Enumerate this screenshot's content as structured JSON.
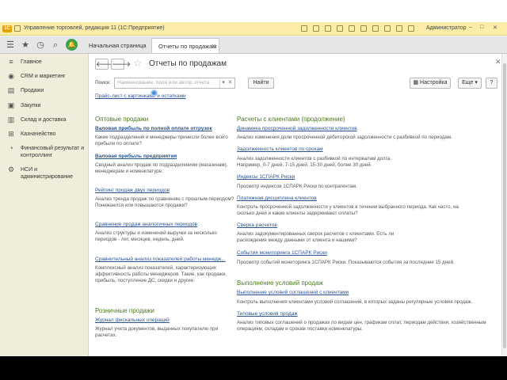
{
  "titlebar": {
    "title": "Управление торговлей, редакция 11  (1С:Предприятие)",
    "user": "Администратор"
  },
  "topbar": {
    "tabs": [
      {
        "label": "Начальная страница"
      },
      {
        "label": "Отчеты по продажам"
      }
    ]
  },
  "sidebar": {
    "items": [
      {
        "label": "Главное",
        "icon": "menu-icon"
      },
      {
        "label": "CRM и маркетинг",
        "icon": "crm-icon"
      },
      {
        "label": "Продажи",
        "icon": "sales-icon"
      },
      {
        "label": "Закупки",
        "icon": "purchases-icon"
      },
      {
        "label": "Склад и доставка",
        "icon": "warehouse-icon"
      },
      {
        "label": "Казначейство",
        "icon": "treasury-icon"
      },
      {
        "label": "Финансовый результат и контроллинг",
        "icon": "finance-icon"
      },
      {
        "label": "НСИ и администрирование",
        "icon": "settings-icon"
      }
    ]
  },
  "main": {
    "title": "Отчеты по продажам",
    "search": {
      "label": "Поиск:",
      "placeholder": "Наименование, поля или автор отчета",
      "find_button": "Найти"
    },
    "settings_button": "Настройка",
    "more_button": "Еще",
    "help_button": "?",
    "price_link": "Прайс-лист с картинками и остатками",
    "left_sections": [
      {
        "heading": "Оптовые продажи",
        "reports": [
          {
            "title": "Валовая прибыль по полной оплате отгрузок",
            "bold": true,
            "desc": "Какие подразделения и менеджеры принесли более всего прибыли по оплате?"
          },
          {
            "title": "Валовая прибыль предприятия",
            "bold": true,
            "desc": "Сводный анализ продаж по подразделениям (магазинам), менеджерам и номенклатуре."
          },
          {
            "title": "Рейтинг продаж двух периодов",
            "bold": false,
            "desc": "Анализ тренда продаж по сравнению с прошлым периодом? Понижаются или повышаются продажи?"
          },
          {
            "title": "Сравнение продаж аналогичных периодов",
            "bold": false,
            "desc": "Анализ структуры и изменений выручки за несколько периодов - лет, месяцев, недель, дней."
          },
          {
            "title": "Сравнительный анализ показателей работы менедж...",
            "bold": false,
            "desc": "Комплексный анализ показателей, характеризующих эффективность работы менеджеров. Такие, как продажи, прибыль, поступление ДС, скидки и другие."
          }
        ]
      },
      {
        "heading": "Розничные продажи",
        "reports": [
          {
            "title": "Журнал фискальных операций",
            "bold": false,
            "desc": "Журнал учета документов, выданных покупателю при расчетах."
          }
        ]
      }
    ],
    "right_sections": [
      {
        "heading": "Расчеты с клиентами (продолжение)",
        "reports": [
          {
            "title": "Динамика просроченной задолженности клиентов",
            "desc": "Анализ изменения доли просроченной дебиторской задолженности с разбивкой по периодам."
          },
          {
            "title": "Задолженность клиентов по срокам",
            "desc": "Анализ задолженности клиентов с разбивкой по интервалам долга. Например, 0-7 дней, 7-15 дней, 15-30 дней, более 30 дней."
          },
          {
            "title": "Индексы 1СПАРК Риски",
            "desc": "Просмотр индексов 1СПАРК Риски по контрагентам."
          },
          {
            "title": "Платежная дисциплина клиентов",
            "desc": "Контроль просроченной задолженности у клиентов в течении выбранного периода. Как часто, на сколько дней и какие клиенты задерживают оплаты?"
          },
          {
            "title": "Сверка расчетов",
            "desc": "Анализ задокументированных сверок расчетов с клиентами. Есть ли расхождения между данными от клиента и нашими?"
          },
          {
            "title": "События мониторинга 1СПАРК Риски",
            "desc": "Просмотр событий мониторинга 1СПАРК Риски. Показываются события за последние 15 дней."
          }
        ]
      },
      {
        "heading": "Выполнение условий продаж",
        "reports": [
          {
            "title": "Выполнение условий соглашений с клиентами",
            "desc": "Контроль выполнения клиентами условий соглашений, в которых заданы регулярные условия продаж."
          },
          {
            "title": "Типовые условия продаж",
            "desc": "Анализ типовых соглашений о продажах по видам цен, графикам оплат, периодам действия, хозяйственным операциям, складам и срокам поставки номенклатуры."
          }
        ]
      }
    ]
  }
}
